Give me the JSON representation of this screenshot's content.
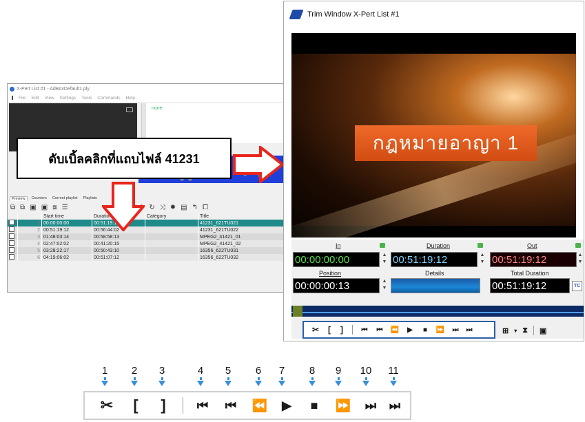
{
  "left_window": {
    "title": "X-Pert List #1 - AdBoxDefault1.ply",
    "menu": [
      "File",
      "Edit",
      "View",
      "Settings",
      "Tools",
      "Commands",
      "Help"
    ],
    "status_text": "none",
    "tabs": [
      "Preview",
      "Counters",
      "Current playlist",
      "Playlists"
    ],
    "columns": [
      "",
      "",
      "Start time",
      "Duration",
      "Category",
      "Title"
    ],
    "rows": [
      {
        "index": "1",
        "start": "00:00:00:00",
        "duration": "00:51:19:12",
        "category": "",
        "title": "41231_621TU021"
      },
      {
        "index": "2",
        "start": "00:51:19:12",
        "duration": "00:56:44:02",
        "category": "",
        "title": "41231_621TU022"
      },
      {
        "index": "3",
        "start": "01:48:03:14",
        "duration": "00:58:58:13",
        "category": "",
        "title": "MPEG2_41421_01"
      },
      {
        "index": "4",
        "start": "02:47:02:02",
        "duration": "00:41:20:15",
        "category": "",
        "title": "MPEG2_41421_02"
      },
      {
        "index": "5",
        "start": "03:28:22:17",
        "duration": "00:50:43:10",
        "category": "",
        "title": "16356_622TU031"
      },
      {
        "index": "6",
        "start": "04:19:06:02",
        "duration": "00:51:07:12",
        "category": "",
        "title": "16356_622TU032"
      }
    ]
  },
  "callout": {
    "text": "ดับเบิ้ลคลิกที่แถบไฟล์ 41231"
  },
  "trim_window": {
    "title": "Trim Window X-Pert List #1",
    "video_banner": "กฎหมายอาญา 1",
    "in_label": "In",
    "in_value": "00:00:00:00",
    "duration_label": "Duration",
    "duration_value": "00:51:19:12",
    "out_label": "Out",
    "out_value": "00:51:19:12",
    "position_label": "Position",
    "position_value": "00:00:00:13",
    "details_label": "Details",
    "total_duration_label": "Total Duration",
    "total_duration_value": "00:51:19:12",
    "tc_button": "TC"
  },
  "transport_numbers": [
    "1",
    "2",
    "3",
    "4",
    "5",
    "6",
    "7",
    "8",
    "9",
    "10",
    "11"
  ],
  "transport_icons": [
    "cut-icon",
    "mark-in-icon",
    "mark-out-icon",
    "go-to-start-icon",
    "previous-icon",
    "rewind-icon",
    "play-icon",
    "stop-icon",
    "fast-forward-icon",
    "next-icon",
    "go-to-end-icon"
  ],
  "colors": {
    "arrow_red": "#e8261c",
    "selected_row": "#1f8a8a",
    "timecode_green": "#5de04a",
    "timecode_red": "#ff8a8a",
    "ctrl_border": "#2d5fa8"
  }
}
